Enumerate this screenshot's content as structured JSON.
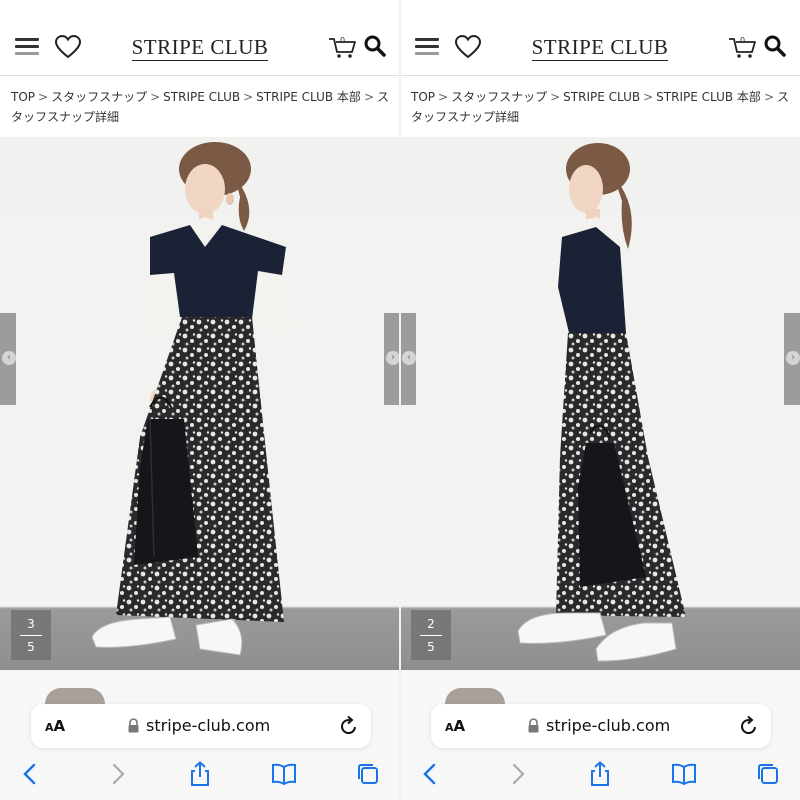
{
  "panels": [
    {
      "header": {
        "brand": "STRIPE CLUB",
        "cart_count": "0"
      },
      "breadcrumb": [
        "TOP",
        "スタッフスナップ",
        "STRIPE CLUB",
        "STRIPE CLUB 本部",
        "スタッフスナップ詳細"
      ],
      "photo": {
        "current": "3",
        "total": "5",
        "alt": "Staff snap: model in navy vest, white blouse, floral maxi skirt, black bag, white sneakers"
      },
      "browser": {
        "reader_label": "AA",
        "url": "stripe-club.com"
      }
    },
    {
      "header": {
        "brand": "STRIPE CLUB",
        "cart_count": "0"
      },
      "breadcrumb": [
        "TOP",
        "スタッフスナップ",
        "STRIPE CLUB",
        "STRIPE CLUB 本部",
        "スタッフスナップ詳細"
      ],
      "photo": {
        "current": "2",
        "total": "5",
        "alt": "Staff snap side view: navy vest, white blouse, floral maxi skirt, black bag, white sneakers"
      },
      "browser": {
        "reader_label": "AA",
        "url": "stripe-club.com"
      }
    }
  ],
  "theme": {
    "accent": "#1a73e8",
    "text": "#222222",
    "tab_gray": "#9c9c9c",
    "vest": "#1c2235",
    "skirt_dark": "#2a2a2e",
    "skirt_light": "#e8e6df"
  },
  "icons": [
    "menu-icon",
    "heart-icon",
    "cart-icon",
    "search-icon",
    "chevron-left-icon",
    "lock-icon",
    "reload-icon",
    "back-icon",
    "forward-icon",
    "share-icon",
    "bookmarks-icon",
    "tabs-icon"
  ]
}
